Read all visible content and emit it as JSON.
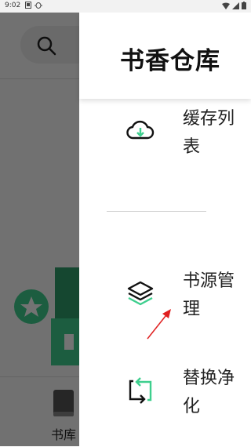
{
  "status_bar": {
    "time": "9:02"
  },
  "background": {
    "bottom_nav": {
      "bookshelf_label": "书库"
    }
  },
  "drawer": {
    "title": "书香仓库",
    "menu_items": [
      {
        "label": "缓存列表",
        "icon": "cloud-download-icon"
      },
      {
        "label": "书源管理",
        "icon": "layers-icon"
      },
      {
        "label": "替换净化",
        "icon": "replace-arrows-icon"
      }
    ]
  },
  "colors": {
    "accent": "#3ecf8e",
    "arrow": "#e02020"
  }
}
